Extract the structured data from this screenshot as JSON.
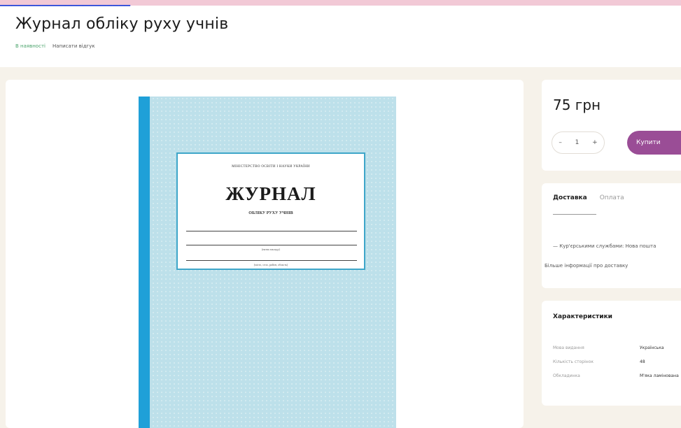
{
  "product": {
    "title": "Журнал обліку руху учнів",
    "availability": "В наявності",
    "review_link": "Написати відгук"
  },
  "cover": {
    "ministry": "МІНІСТЕРСТВО ОСВІТИ І НАУКИ УКРАЇНИ",
    "title": "ЖУРНАЛ",
    "subtitle": "ОБЛІКУ РУХУ УЧНІВ",
    "caption_school": "(назва закладу)",
    "caption_place": "(місто, село, район, область)"
  },
  "purchase": {
    "price": "75 грн",
    "minus": "–",
    "quantity": "1",
    "plus": "+",
    "buy_label": "Купити"
  },
  "delivery": {
    "tabs": [
      "Доставка",
      "Оплата"
    ],
    "line": "— Кур'єрськими службами: Нова пошта",
    "more": "Більше інформації про доставку"
  },
  "specs": {
    "title": "Характеристики",
    "rows": [
      {
        "key": "Мова видання",
        "value": "Українська"
      },
      {
        "key": "Кількість сторінок",
        "value": "48"
      },
      {
        "key": "Обкладинка",
        "value": "М'яка ламінована"
      }
    ]
  }
}
